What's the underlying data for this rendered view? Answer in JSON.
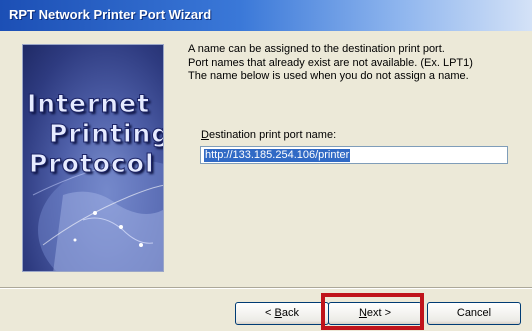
{
  "window": {
    "title": "RPT Network Printer Port Wizard"
  },
  "banner": {
    "line1": "Internet",
    "line2": "Printing",
    "line3": "Protocol"
  },
  "description": [
    "A name can be assigned to the destination print port.",
    "Port names that already exist are not available. (Ex. LPT1)",
    "The name below is used when you do not assign a name."
  ],
  "port_field": {
    "label_mnemonic": "D",
    "label_rest": "estination print port name:",
    "value": "http://133.185.254.106/printer"
  },
  "buttons": {
    "back_prefix": "< ",
    "back_mnemonic": "B",
    "back_rest": "ack",
    "next_mnemonic": "N",
    "next_rest": "ext >",
    "cancel": "Cancel"
  },
  "colors": {
    "title_bar": "#1c4fb5",
    "highlight": "#c0141b",
    "selection": "#316ac5",
    "dialog_bg": "#ece9d8"
  }
}
